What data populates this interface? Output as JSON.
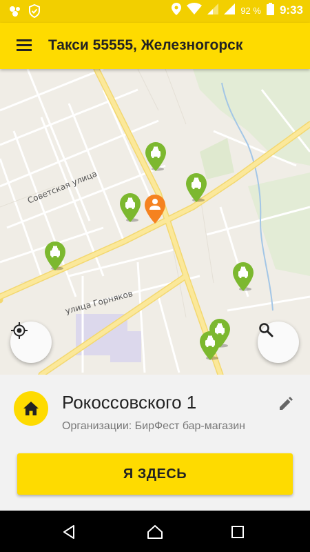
{
  "status_bar": {
    "battery_percent": "92 %",
    "time": "9:33",
    "icons": [
      "sync-icon",
      "shield-check-icon",
      "location-icon",
      "wifi-icon",
      "signal-icon",
      "signal-icon",
      "battery-icon"
    ]
  },
  "app_bar": {
    "title": "Такси 55555, Железногорск",
    "menu_icon": "hamburger-menu-icon"
  },
  "map": {
    "street_labels": [
      "Советская улица",
      "улица Горняков"
    ],
    "taxi_icon": "taxi-car-icon",
    "user_icon": "person-icon",
    "taxi_count": 8,
    "colors": {
      "taxi_pin": "#7cb82f",
      "user_pin": "#f58220",
      "map_bg": "#f0ede6",
      "road_major": "#fbe08a"
    }
  },
  "controls": {
    "locate_icon": "my-location-icon",
    "search_icon": "search-icon"
  },
  "address": {
    "main": "Рокоссовского 1",
    "sub": "Организации: БирФест бар-магазин",
    "home_icon": "home-icon",
    "edit_icon": "pencil-icon"
  },
  "action": {
    "here_label": "Я ЗДЕСЬ"
  },
  "nav_bar": {
    "icons": [
      "back-icon",
      "home-outline-icon",
      "recents-icon"
    ]
  },
  "colors": {
    "accent": "#fedb00",
    "status_bar": "#f2cf00"
  }
}
